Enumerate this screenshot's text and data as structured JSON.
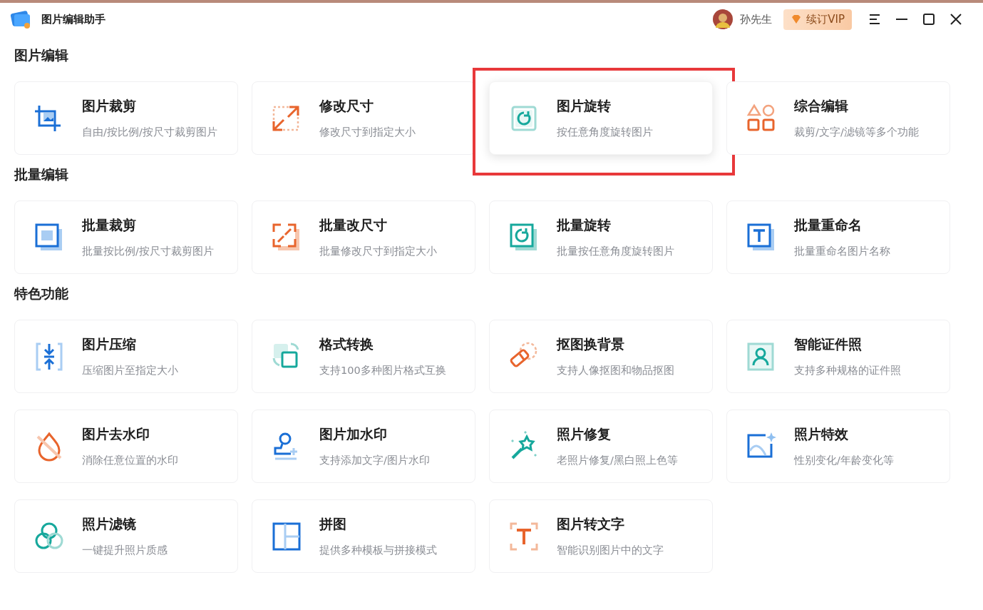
{
  "window": {
    "title": "图片编辑助手"
  },
  "account": {
    "user_name": "孙先生",
    "vip_button": "续订VIP"
  },
  "sections": [
    {
      "title": "图片编辑",
      "items": [
        {
          "kind": "crop",
          "title": "图片裁剪",
          "subtitle": "自由/按比例/按尺寸裁剪图片",
          "highlighted": false
        },
        {
          "kind": "resize",
          "title": "修改尺寸",
          "subtitle": "修改尺寸到指定大小",
          "highlighted": false
        },
        {
          "kind": "rotate",
          "title": "图片旋转",
          "subtitle": "按任意角度旋转图片",
          "highlighted": true
        },
        {
          "kind": "shapes",
          "title": "综合编辑",
          "subtitle": "裁剪/文字/滤镜等多个功能",
          "highlighted": false
        }
      ]
    },
    {
      "title": "批量编辑",
      "items": [
        {
          "kind": "batch-crop",
          "title": "批量裁剪",
          "subtitle": "批量按比例/按尺寸裁剪图片",
          "highlighted": false
        },
        {
          "kind": "batch-resize",
          "title": "批量改尺寸",
          "subtitle": "批量修改尺寸到指定大小",
          "highlighted": false
        },
        {
          "kind": "batch-rotate",
          "title": "批量旋转",
          "subtitle": "批量按任意角度旋转图片",
          "highlighted": false
        },
        {
          "kind": "rename",
          "title": "批量重命名",
          "subtitle": "批量重命名图片名称",
          "highlighted": false
        }
      ]
    },
    {
      "title": "特色功能",
      "items": [
        {
          "kind": "compress",
          "title": "图片压缩",
          "subtitle": "压缩图片至指定大小",
          "highlighted": false
        },
        {
          "kind": "convert",
          "title": "格式转换",
          "subtitle": "支持100多种图片格式互换",
          "highlighted": false
        },
        {
          "kind": "cutout",
          "title": "抠图换背景",
          "subtitle": "支持人像抠图和物品抠图",
          "highlighted": false
        },
        {
          "kind": "id-photo",
          "title": "智能证件照",
          "subtitle": "支持多种规格的证件照",
          "highlighted": false
        },
        {
          "kind": "unwatermark",
          "title": "图片去水印",
          "subtitle": "消除任意位置的水印",
          "highlighted": false
        },
        {
          "kind": "watermark",
          "title": "图片加水印",
          "subtitle": "支持添加文字/图片水印",
          "highlighted": false
        },
        {
          "kind": "repair",
          "title": "照片修复",
          "subtitle": "老照片修复/黑白照上色等",
          "highlighted": false
        },
        {
          "kind": "effects",
          "title": "照片特效",
          "subtitle": "性别变化/年龄变化等",
          "highlighted": false
        },
        {
          "kind": "filter",
          "title": "照片滤镜",
          "subtitle": "一键提升照片质感",
          "highlighted": false
        },
        {
          "kind": "collage",
          "title": "拼图",
          "subtitle": "提供多种模板与拼接模式",
          "highlighted": false
        },
        {
          "kind": "ocr",
          "title": "图片转文字",
          "subtitle": "智能识别图片中的文字",
          "highlighted": false
        }
      ]
    }
  ]
}
